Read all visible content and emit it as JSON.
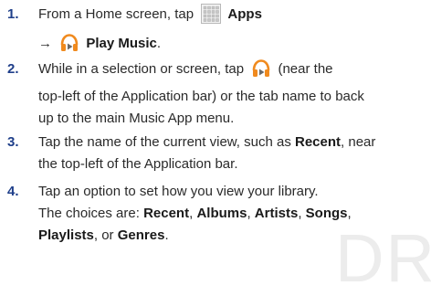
{
  "watermark": "DR",
  "steps": [
    {
      "num": "1.",
      "t1": "From a Home screen, tap",
      "apps_label": "Apps",
      "arrow": "→",
      "play_music_label": "Play Music",
      "end": "."
    },
    {
      "num": "2.",
      "t1": "While in a selection or screen, tap",
      "t2": "(near the",
      "line2": "top-left of the Application bar) or the tab name to back",
      "line3": "up to the main Music App menu."
    },
    {
      "num": "3.",
      "t1": "Tap the name of the current view, such as",
      "recent": "Recent",
      "t2": ", near",
      "line2": "the top-left of the Application bar."
    },
    {
      "num": "4.",
      "line1": "Tap an option to set how you view your library.",
      "t1": "The choices are:",
      "c1": "Recent",
      "sep1": ",",
      "c2": "Albums",
      "sep2": ",",
      "c3": "Artists",
      "sep3": ",",
      "c4": "Songs",
      "sep4": ",",
      "c5": "Playlists",
      "sep5": ", or",
      "c6": "Genres",
      "end": "."
    }
  ],
  "icons": [
    "apps-grid-icon",
    "play-music-headphones-icon"
  ],
  "colors": {
    "step_number": "#1f3f8a",
    "headphone_orange": "#f08a1e",
    "apps_grid": "#b8b8b8"
  }
}
